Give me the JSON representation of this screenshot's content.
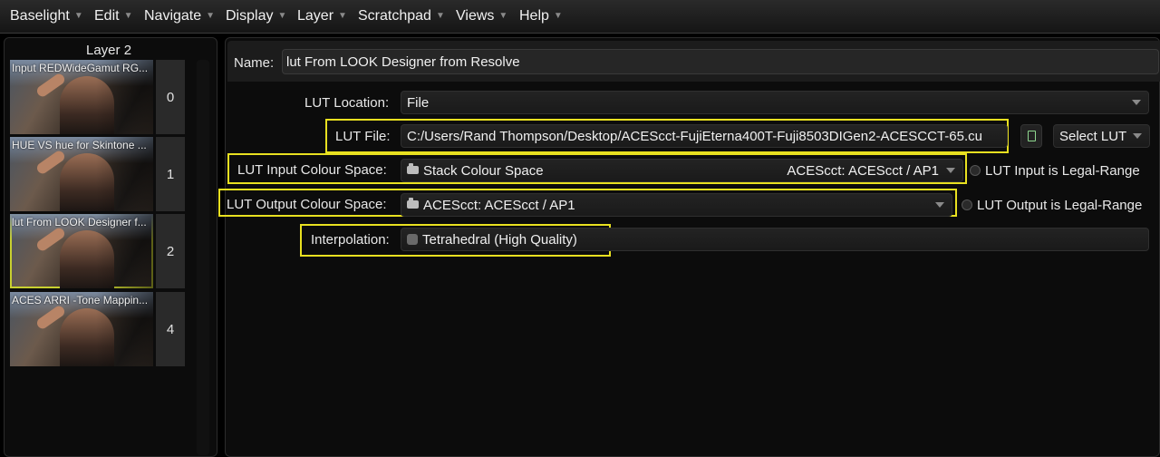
{
  "menu": [
    "Baselight",
    "Edit",
    "Navigate",
    "Display",
    "Layer",
    "Scratchpad",
    "Views",
    "Help"
  ],
  "layers_panel": {
    "title": "Layer 2",
    "layers": [
      {
        "label": "Input REDWideGamut RG...",
        "number": "0",
        "selected": false
      },
      {
        "label": "HUE VS hue for Skintone ...",
        "number": "1",
        "selected": false
      },
      {
        "label": "lut From LOOK Designer f...",
        "number": "2",
        "selected": true
      },
      {
        "label": "ACES ARRI -Tone Mappin...",
        "number": "4",
        "selected": false
      }
    ]
  },
  "properties": {
    "name_label": "Name:",
    "name_value": "lut From LOOK Designer from Resolve",
    "lut_location_label": "LUT Location:",
    "lut_location_value": "File",
    "lut_file_label": "LUT File:",
    "lut_file_value": "C:/Users/Rand Thompson/Desktop/ACEScct-FujiEterna400T-Fuji8503DIGen2-ACESCCT-65.cu",
    "select_lut_label": "Select LUT",
    "input_cs_label": "LUT Input Colour Space:",
    "input_cs_value": "Stack Colour Space",
    "input_cs_detail": "ACEScct: ACEScct / AP1",
    "input_legal_label": "LUT Input is Legal-Range",
    "output_cs_label": "LUT Output Colour Space:",
    "output_cs_value": "ACEScct: ACEScct / AP1",
    "output_legal_label": "LUT Output is Legal-Range",
    "interpolation_label": "Interpolation:",
    "interpolation_value": "Tetrahedral (High Quality)"
  },
  "colors": {
    "highlight": "#e8e020",
    "background": "#000000",
    "file_icon": "#8fd88f"
  },
  "icons": [
    "chevron-down-icon",
    "camera-icon",
    "file-icon",
    "radio-icon"
  ]
}
